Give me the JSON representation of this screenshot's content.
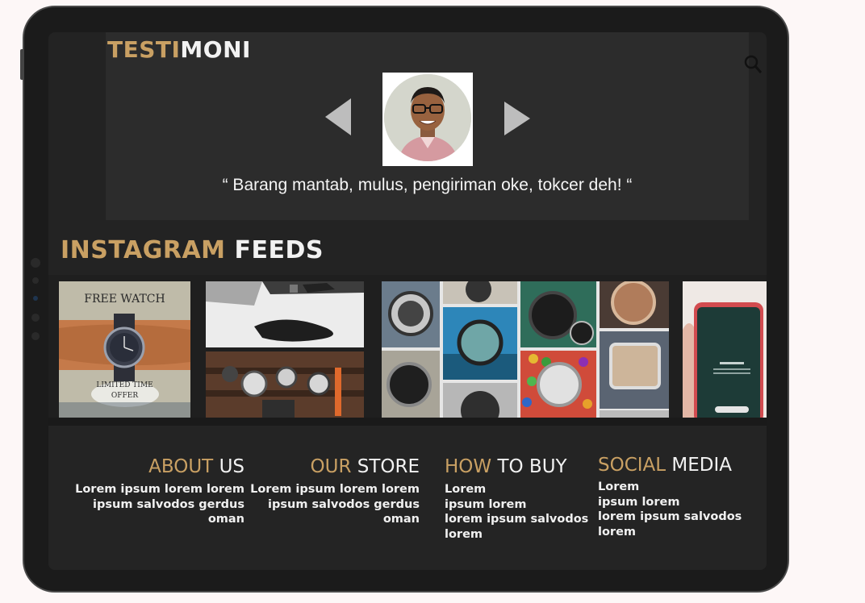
{
  "testimoni": {
    "title_gold": "TESTI",
    "title_white": "MONI",
    "quote": "“ Barang mantab, mulus, pengiriman oke, tokcer deh! “",
    "prev_icon": "triangle-left-icon",
    "next_icon": "triangle-right-icon"
  },
  "header": {
    "search_icon": "search-icon"
  },
  "instagram": {
    "title_gold": "INSTAGRAM",
    "title_white": "FEEDS",
    "post1": {
      "top_text": "FREE WATCH",
      "bottom_text_1": "LIMITED TIME",
      "bottom_text_2": "OFFER"
    }
  },
  "footer": {
    "about": {
      "gold": "ABOUT",
      "white": "US",
      "lines": [
        "Lorem ipsum lorem lorem",
        "ipsum salvodos gerdus",
        "oman"
      ]
    },
    "store": {
      "gold": "OUR",
      "white": "STORE",
      "lines": [
        "Lorem ipsum lorem lorem",
        "ipsum salvodos gerdus",
        "oman"
      ]
    },
    "howto": {
      "gold": "HOW",
      "white": "TO BUY",
      "lines": [
        "Lorem",
        "ipsum lorem",
        "lorem ipsum salvodos",
        "lorem"
      ]
    },
    "social": {
      "gold": "SOCIAL",
      "white": "MEDIA",
      "lines": [
        "Lorem",
        "ipsum lorem",
        "lorem ipsum salvodos",
        "lorem"
      ]
    }
  },
  "colors": {
    "accent_gold": "#c9a063",
    "background": "#232323",
    "panel": "#2c2c2c"
  }
}
